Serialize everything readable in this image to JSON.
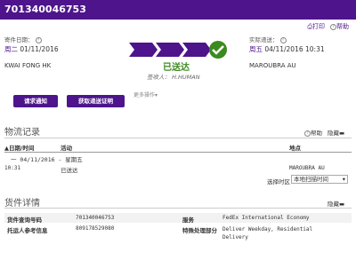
{
  "tracking_number": "701340046753",
  "top_links": {
    "print": "打印",
    "help": "帮助"
  },
  "ship": {
    "label": "寄件日期：",
    "day": "周二",
    "date": "01/11/2016",
    "city": "KWAI FONG HK"
  },
  "actual": {
    "label": "实际递送：",
    "day": "周五",
    "date": "04/11/2016 10:31",
    "city": "MAROUBRA AU"
  },
  "status": {
    "text": "已送达",
    "signed_label": "签收人：",
    "signed_by": "H.HUMAN"
  },
  "buttons": {
    "notify": "请求通知",
    "proof": "获取递送证明",
    "more": "更多操作▾"
  },
  "travel": {
    "title": "物流记录",
    "help": "帮助",
    "collapse": "隐藏",
    "headers": {
      "date": "▲日期/时间",
      "activity": "活动",
      "location": "地点"
    },
    "day_row": "一  04/11/2016 - 星期五",
    "events": [
      {
        "time": "10:31",
        "activity": "已送达",
        "location": "MAROUBRA AU"
      }
    ],
    "timezone_label": "选择时区",
    "timezone_value": "本地扫描时间"
  },
  "details": {
    "title": "货件详情",
    "collapse": "隐藏",
    "rows": [
      {
        "label1": "货件查询号码",
        "value1": "701340046753",
        "label2": "服务",
        "value2": "FedEx International Economy"
      },
      {
        "label1": "托运人参考信息",
        "value1": "809178529080",
        "label2": "特殊处理部分",
        "value2": "Deliver Weekday, Residential Delivery"
      }
    ]
  },
  "colors": {
    "brand": "#4d148c",
    "delivered": "#3b8a1e"
  }
}
